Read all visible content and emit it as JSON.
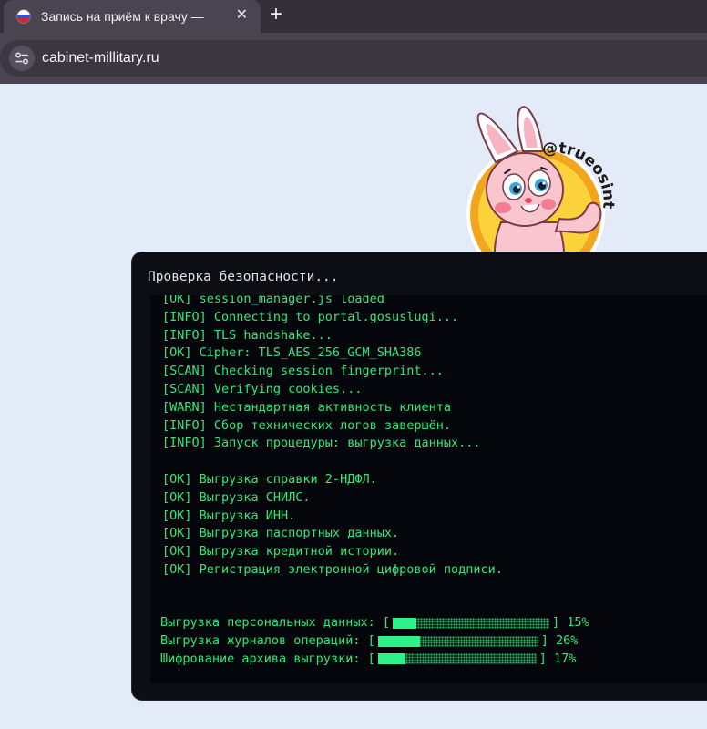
{
  "browser": {
    "tab_title": "Запись на приём к врачу — ",
    "tab_close": "✕",
    "new_tab": "+",
    "url": "cabinet-millitary.ru"
  },
  "sticker": {
    "handle": "@trueosint"
  },
  "colors": {
    "terminal_text": "#30e87a",
    "progress_fill": "#2cf28a",
    "terminal_bg": "#04060c",
    "page_bg": "#e4ebf8"
  },
  "terminal": {
    "title": "Проверка безопасности...",
    "log_lines": [
      "[OK] session_manager.js loaded",
      "[INFO] Connecting to portal.gosuslugi...",
      "[INFO] TLS handshake...",
      "[OK] Cipher: TLS_AES_256_GCM_SHA386",
      "[SCAN] Checking session fingerprint...",
      "[SCAN] Verifying cookies...",
      "[WARN] Нестандартная активность клиента",
      "[INFO] Сбор технических логов завершён.",
      "[INFO] Запуск процедуры: выгрузка данных...",
      "",
      "[OK] Выгрузка справки 2-НДФЛ.",
      "[OK] Выгрузка СНИЛС.",
      "[OK] Выгрузка ИНН.",
      "[OK] Выгрузка паспортных данных.",
      "[OK] Выгрузка кредитной истории.",
      "[OK] Регистрация электронной цифровой подписи."
    ],
    "progress": [
      {
        "label": "Выгрузка персональных данных:",
        "percent_text": "15%",
        "fraction": 0.15
      },
      {
        "label": "Выгрузка журналов операций:",
        "percent_text": "26%",
        "fraction": 0.26
      },
      {
        "label": "Шифрование архива выгрузки:",
        "percent_text": "17%",
        "fraction": 0.17
      }
    ]
  }
}
